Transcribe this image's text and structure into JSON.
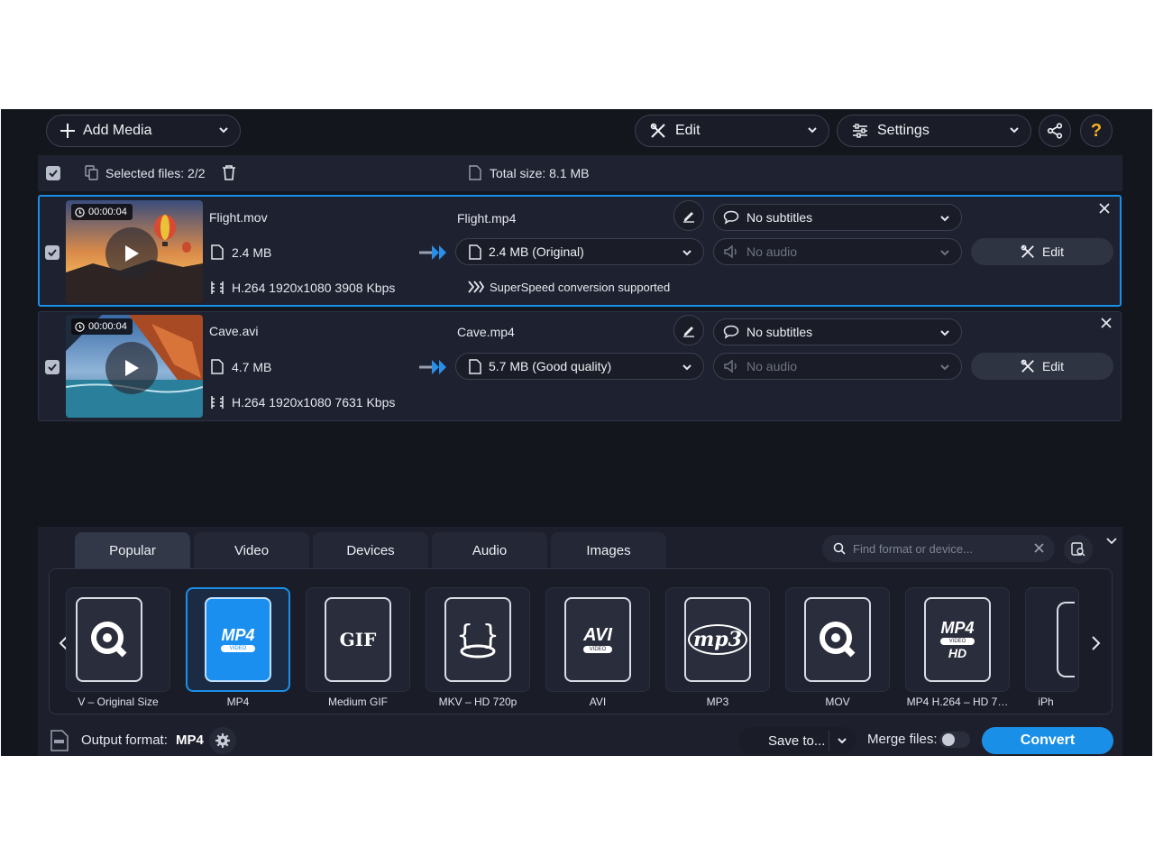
{
  "toolbar": {
    "add_media_label": "Add Media",
    "edit_label": "Edit",
    "settings_label": "Settings",
    "help_glyph": "?"
  },
  "selection": {
    "selected_label": "Selected files: 2/2",
    "total_size_label": "Total size: 8.1 MB"
  },
  "files": [
    {
      "duration": "00:00:04",
      "source_name": "Flight.mov",
      "source_size": "2.4 MB",
      "source_codec": "H.264 1920x1080 3908 Kbps",
      "output_name": "Flight.mp4",
      "output_size": "2.4 MB (Original)",
      "superspeed": "SuperSpeed conversion supported",
      "subtitles": "No subtitles",
      "audio": "No audio",
      "edit_label": "Edit"
    },
    {
      "duration": "00:00:04",
      "source_name": "Cave.avi",
      "source_size": "4.7 MB",
      "source_codec": "H.264 1920x1080 7631 Kbps",
      "output_name": "Cave.mp4",
      "output_size": "5.7 MB (Good quality)",
      "subtitles": "No subtitles",
      "audio": "No audio",
      "edit_label": "Edit"
    }
  ],
  "tabs": [
    "Popular",
    "Video",
    "Devices",
    "Audio",
    "Images"
  ],
  "search": {
    "placeholder": "Find format or device..."
  },
  "formats": [
    {
      "label": "V – Original Size",
      "icon": "quicktime-icon"
    },
    {
      "label": "MP4",
      "icon": "mp4-icon",
      "selected": true
    },
    {
      "label": "Medium GIF",
      "icon": "gif-icon"
    },
    {
      "label": "MKV – HD 720p",
      "icon": "mkv-icon"
    },
    {
      "label": "AVI",
      "icon": "avi-icon"
    },
    {
      "label": "MP3",
      "icon": "mp3-icon"
    },
    {
      "label": "MOV",
      "icon": "quicktime-icon"
    },
    {
      "label": "MP4 H.264 – HD 7…",
      "icon": "mp4-hd-icon"
    },
    {
      "label": "iPh",
      "icon": "iphone-icon"
    }
  ],
  "format_icon_text": {
    "mp4": "MP4",
    "video": "VIDEO",
    "gif": "GIF",
    "avi": "AVI",
    "mp3": "mp3",
    "hd": "HD"
  },
  "bottom": {
    "output_format_label": "Output format:",
    "output_format_value": "MP4",
    "save_to_label": "Save to...",
    "merge_label": "Merge files:",
    "convert_label": "Convert"
  },
  "colors": {
    "accent": "#1a8fe8",
    "background": "#14161e",
    "help": "#f2b01e"
  }
}
